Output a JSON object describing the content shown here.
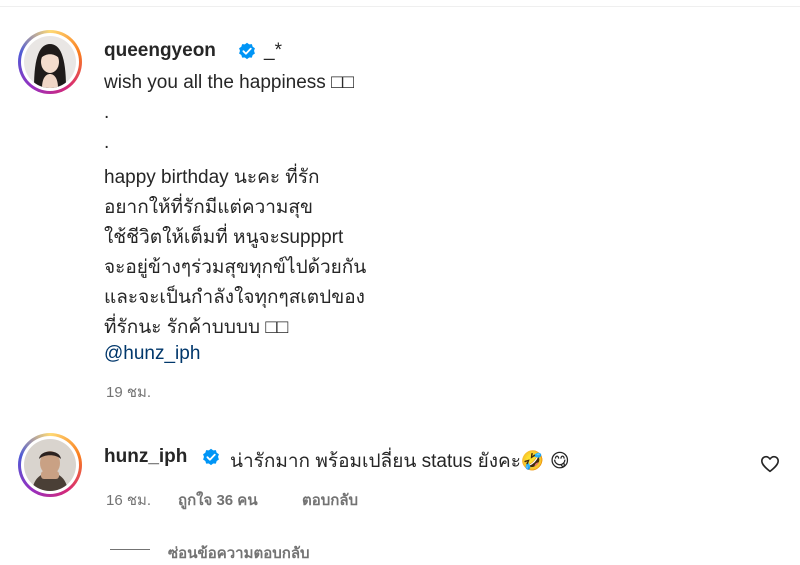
{
  "post_comment": {
    "username": "queengyeon",
    "suffix": "_*",
    "lines": [
      "wish you all the happiness □□",
      ".",
      ".",
      "happy birthday นะคะ ที่รัก",
      "อยากให้ที่รักมีแต่ความสุข",
      "ใช้ชีวิตให้เต็มที่ หนูจะsuppprt",
      "จะอยู่ข้างๆร่วมสุขทุกข์ไปด้วยกัน",
      "และจะเป็นกำลังใจทุกๆสเตปของ",
      "ที่รักนะ รักค้าบบบบ □□"
    ],
    "mention": "@hunz_iph",
    "time": "19 ชม."
  },
  "reply": {
    "username": "hunz_iph",
    "text": "น่ารักมาก พร้อมเปลี่ยน status ยังคะ🤣 😋",
    "time": "16 ชม.",
    "likes": "ถูกใจ 36 คน",
    "reply_label": "ตอบกลับ",
    "hide_replies": "ซ่อนข้อความตอบกลับ"
  },
  "colors": {
    "verified": "#0095f6",
    "mention": "#00376b",
    "meta": "#737373"
  },
  "icons": [
    "verified-badge-icon",
    "heart-outline-icon"
  ]
}
